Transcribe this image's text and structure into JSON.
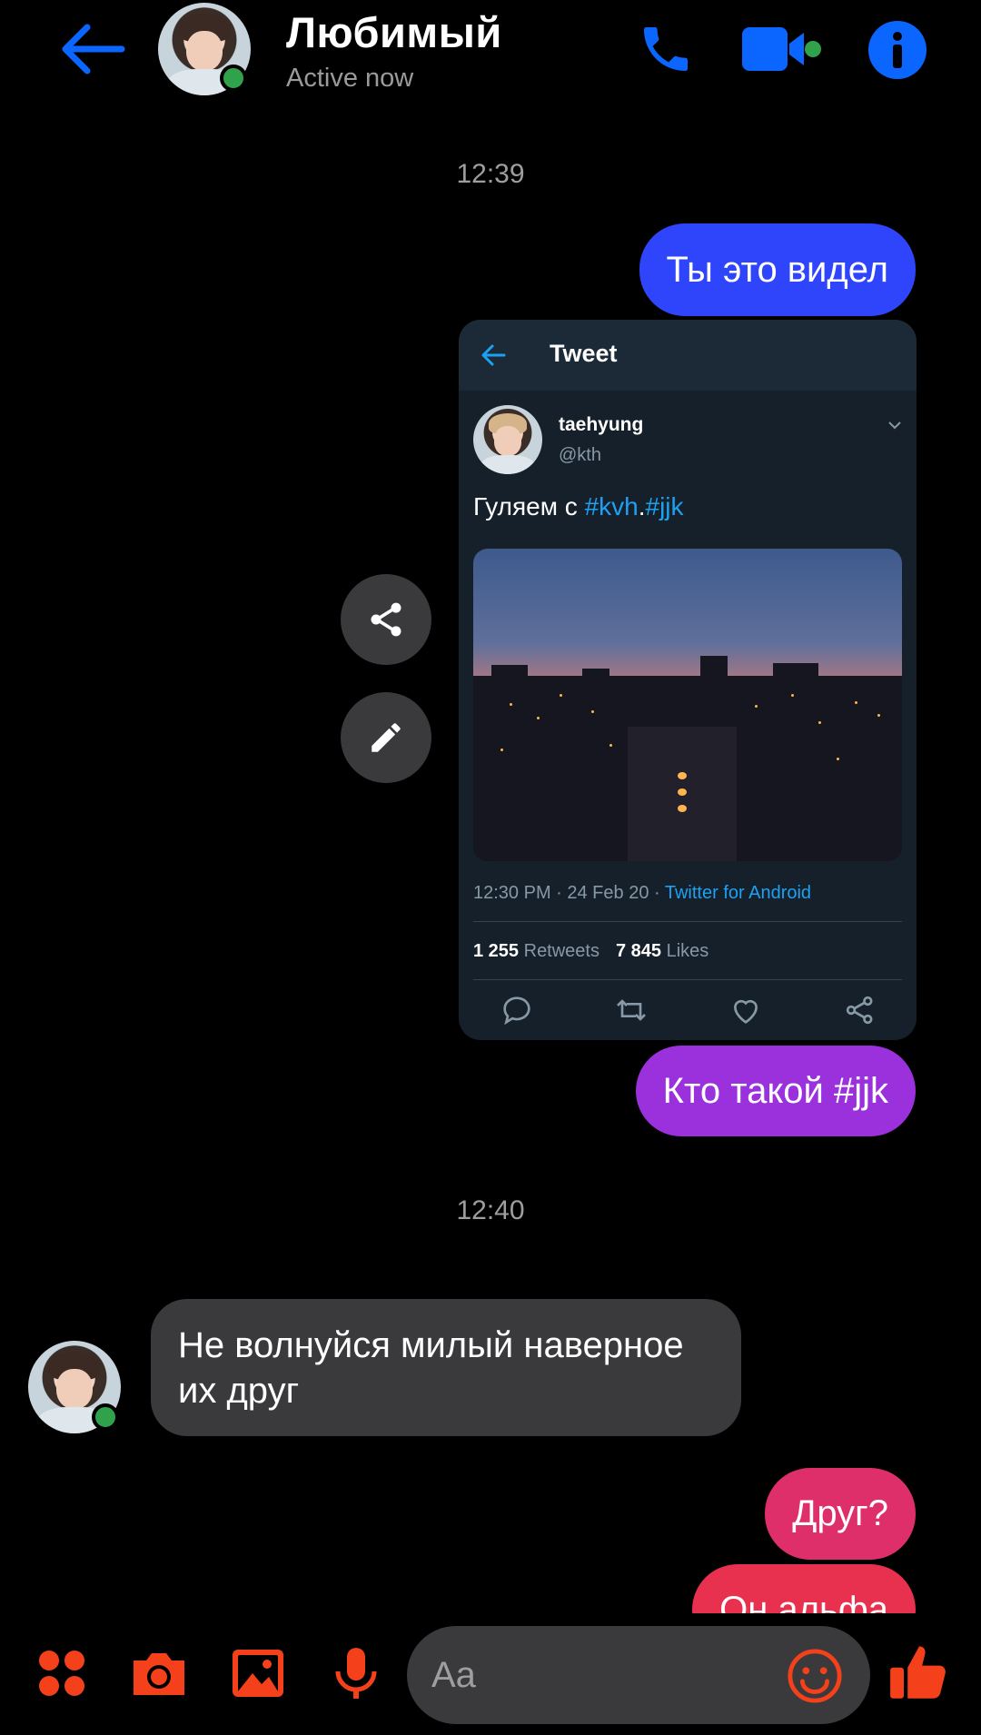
{
  "header": {
    "contact_name": "Любимый",
    "contact_status": "Active now"
  },
  "theme": {
    "accent": "#0a66ff",
    "composer_accent": "#f5411b",
    "online": "#31a24c"
  },
  "messages": {
    "time_1": "12:39",
    "msg_1": "Ты это видел",
    "tweet": {
      "title": "Tweet",
      "name": "taehyung",
      "handle": "@kth",
      "text_plain": "Гуляем с ",
      "hashtag_1": "#kvh",
      "dot": ".",
      "hashtag_2": "#jjk",
      "meta": "12:30 PM · 24 Feb 20 · ",
      "client": "Twitter for Android",
      "retweets_count": "1 255",
      "retweets_label": " Retweets",
      "likes_count": "7 845",
      "likes_label": " Likes"
    },
    "msg_2": "Кто такой #jjk",
    "time_2": "12:40",
    "msg_3": "Не волнуйся милый наверное их друг",
    "msg_4": "Друг?",
    "msg_5": "Он альфа"
  },
  "composer": {
    "placeholder": "Aa"
  },
  "icons": [
    "back-arrow-icon",
    "phone-icon",
    "video-camera-icon",
    "info-icon",
    "share-icon",
    "edit-pencil-icon",
    "apps-grid-icon",
    "camera-icon",
    "gallery-icon",
    "microphone-icon",
    "emoji-icon",
    "thumbs-up-icon"
  ]
}
